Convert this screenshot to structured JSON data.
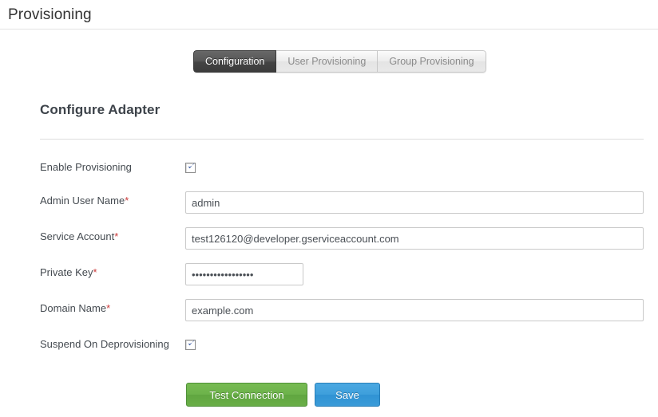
{
  "header": {
    "title": "Provisioning"
  },
  "tabs": [
    {
      "label": "Configuration",
      "active": true
    },
    {
      "label": "User Provisioning",
      "active": false
    },
    {
      "label": "Group Provisioning",
      "active": false
    }
  ],
  "panel": {
    "heading": "Configure Adapter"
  },
  "fields": {
    "enable_provisioning": {
      "label": "Enable Provisioning",
      "required": false,
      "type": "checkbox",
      "checked": true,
      "icon": "checkmark-icon"
    },
    "admin_user_name": {
      "label": "Admin User Name",
      "required": true,
      "required_marker": "*",
      "type": "text",
      "value": "admin",
      "placeholder": ""
    },
    "service_account": {
      "label": "Service Account",
      "required": true,
      "required_marker": "*",
      "type": "text",
      "value": "test126120@developer.gserviceaccount.com",
      "placeholder": ""
    },
    "private_key": {
      "label": "Private Key",
      "required": true,
      "required_marker": "*",
      "type": "password",
      "value": "abcdefghijklmnopq",
      "placeholder": ""
    },
    "domain_name": {
      "label": "Domain Name",
      "required": true,
      "required_marker": "*",
      "type": "text",
      "value": "example.com",
      "placeholder": ""
    },
    "suspend_on_deprovisioning": {
      "label": "Suspend On Deprovisioning",
      "required": false,
      "type": "checkbox",
      "checked": true,
      "icon": "checkmark-icon"
    }
  },
  "actions": {
    "test_connection_label": "Test Connection",
    "save_label": "Save"
  },
  "colors": {
    "active_tab_bg": "#434343",
    "inactive_tab_bg": "#e9e9e9",
    "required_marker": "#cc3b3b",
    "test_connection_green": "#6cb24a",
    "save_blue": "#3e9fdb",
    "checkbox_tick": "#3f5fa8",
    "divider": "#dddddd",
    "input_border": "#c9c9c9"
  }
}
